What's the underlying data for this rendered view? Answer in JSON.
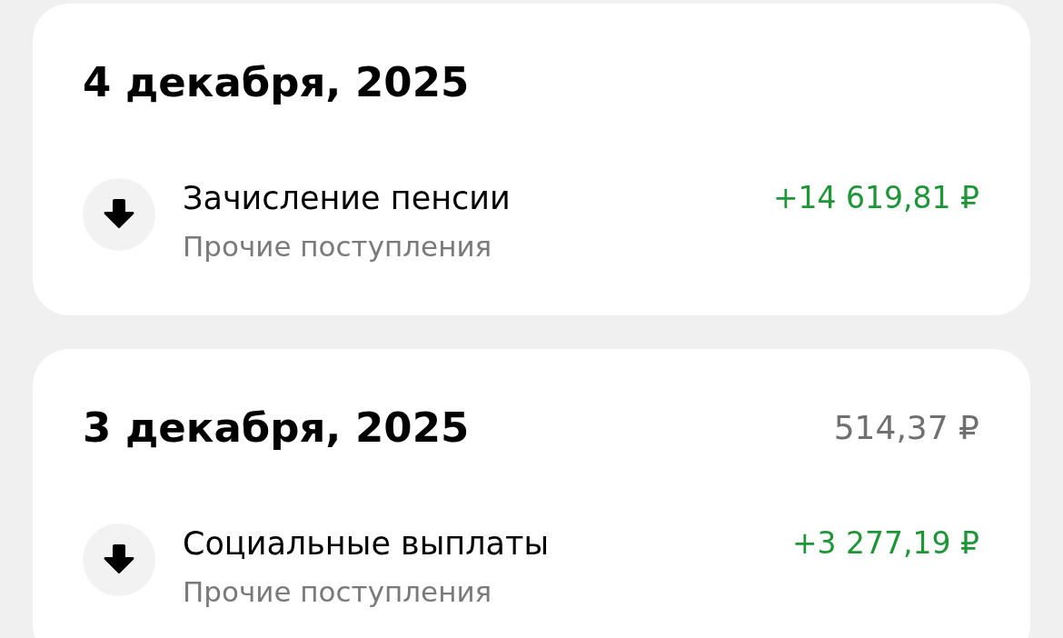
{
  "days": [
    {
      "date": "4 декабря, 2025",
      "transactions": [
        {
          "title": "Зачисление пенсии",
          "category": "Прочие поступления",
          "amount": "+14 619,81 ₽"
        }
      ]
    },
    {
      "date": "3 декабря, 2025",
      "total": "514,37 ₽",
      "transactions": [
        {
          "title": "Социальные выплаты",
          "category": "Прочие поступления",
          "amount": "+3 277,19 ₽"
        }
      ]
    }
  ]
}
